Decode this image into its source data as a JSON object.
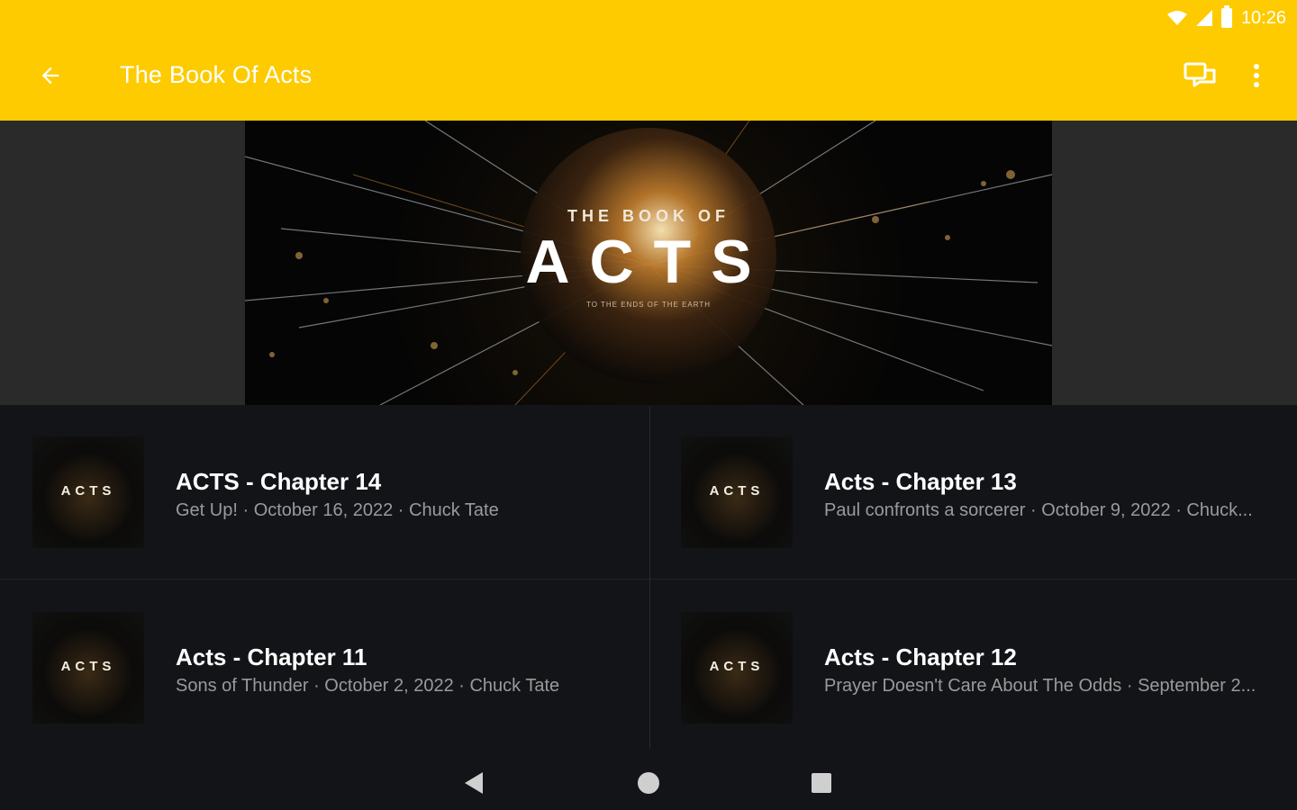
{
  "status_bar": {
    "time": "10:26"
  },
  "app_bar": {
    "title": "The Book Of Acts",
    "back_icon": "arrow-left-icon",
    "chat_icon": "chat-bubbles-icon",
    "more_icon": "more-vert-icon",
    "background": "#fdcb00"
  },
  "hero": {
    "line1": "THE BOOK OF",
    "line2": "ACTS",
    "line3": "TO THE ENDS OF THE EARTH"
  },
  "thumb_label": "ACTS",
  "episodes": [
    {
      "title": "ACTS - Chapter 14",
      "subtitle": "Get Up! · October 16, 2022 · Chuck Tate"
    },
    {
      "title": "Acts - Chapter 13",
      "subtitle": "Paul confronts a sorcerer · October 9, 2022 · Chuck..."
    },
    {
      "title": "Acts - Chapter 11",
      "subtitle": "Sons of Thunder · October 2, 2022 · Chuck Tate"
    },
    {
      "title": "Acts - Chapter 12",
      "subtitle": "Prayer Doesn't Care About The Odds · September 2..."
    }
  ],
  "nav": {
    "back": "triangle-back-icon",
    "home": "circle-home-icon",
    "recents": "square-recents-icon"
  }
}
